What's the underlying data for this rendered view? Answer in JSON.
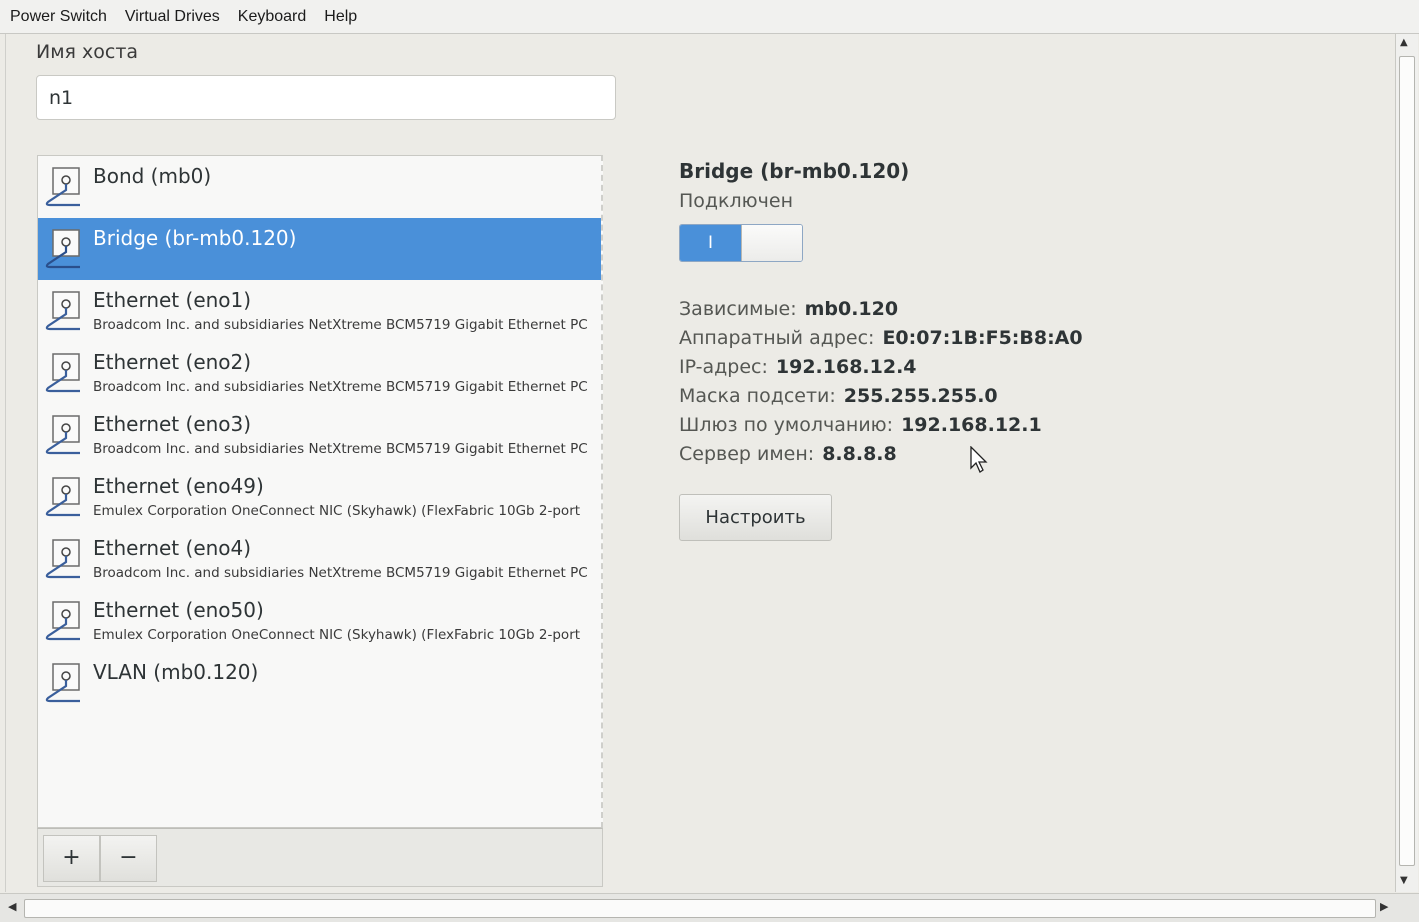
{
  "menubar": {
    "items": [
      "Power Switch",
      "Virtual Drives",
      "Keyboard",
      "Help"
    ]
  },
  "hostname": {
    "label": "Имя хоста",
    "value": "n1"
  },
  "connections": [
    {
      "title": "Bond (mb0)",
      "subtitle": "",
      "selected": false
    },
    {
      "title": "Bridge (br-mb0.120)",
      "subtitle": "",
      "selected": true
    },
    {
      "title": "Ethernet (eno1)",
      "subtitle": "Broadcom Inc. and subsidiaries NetXtreme BCM5719 Gigabit Ethernet PC",
      "selected": false
    },
    {
      "title": "Ethernet (eno2)",
      "subtitle": "Broadcom Inc. and subsidiaries NetXtreme BCM5719 Gigabit Ethernet PC",
      "selected": false
    },
    {
      "title": "Ethernet (eno3)",
      "subtitle": "Broadcom Inc. and subsidiaries NetXtreme BCM5719 Gigabit Ethernet PC",
      "selected": false
    },
    {
      "title": "Ethernet (eno49)",
      "subtitle": "Emulex Corporation OneConnect NIC (Skyhawk) (FlexFabric 10Gb 2-port",
      "selected": false
    },
    {
      "title": "Ethernet (eno4)",
      "subtitle": "Broadcom Inc. and subsidiaries NetXtreme BCM5719 Gigabit Ethernet PC",
      "selected": false
    },
    {
      "title": "Ethernet (eno50)",
      "subtitle": "Emulex Corporation OneConnect NIC (Skyhawk) (FlexFabric 10Gb 2-port",
      "selected": false
    },
    {
      "title": "VLAN (mb0.120)",
      "subtitle": "",
      "selected": false
    }
  ],
  "list_toolbar": {
    "add_label": "+",
    "remove_label": "−"
  },
  "detail": {
    "title": "Bridge (br-mb0.120)",
    "state": "Подключен",
    "toggle_label": "I",
    "toggle_on": true,
    "properties": [
      {
        "label": "Зависимые:",
        "value": "mb0.120"
      },
      {
        "label": "Аппаратный адрес:",
        "value": "E0:07:1B:F5:B8:A0"
      },
      {
        "label": "IP-адрес:",
        "value": "192.168.12.4"
      },
      {
        "label": "Маска подсети:",
        "value": "255.255.255.0"
      },
      {
        "label": "Шлюз по умолчанию:",
        "value": "192.168.12.1"
      },
      {
        "label": "Сервер имен:",
        "value": "8.8.8.8"
      }
    ],
    "configure_label": "Настроить"
  },
  "colors": {
    "accent": "#4a90d9",
    "window_bg": "#ecebe6"
  },
  "icons": {
    "connection": "network-wired-icon"
  }
}
